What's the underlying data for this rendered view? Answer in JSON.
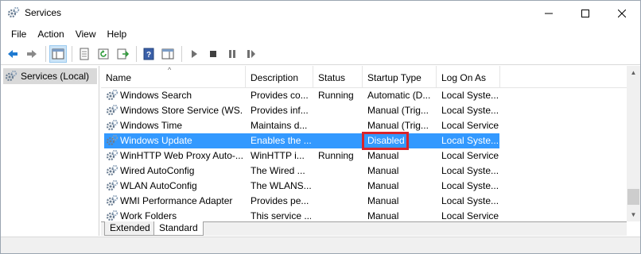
{
  "window": {
    "title": "Services",
    "minimize": "—",
    "maximize": "☐",
    "close": "✕"
  },
  "menu": {
    "file": "File",
    "action": "Action",
    "view": "View",
    "help": "Help"
  },
  "tree": {
    "item": "Services (Local)"
  },
  "columns": {
    "name": "Name",
    "description": "Description",
    "status": "Status",
    "startup": "Startup Type",
    "logon": "Log On As"
  },
  "rows": [
    {
      "name": "Windows Search",
      "description": "Provides co...",
      "status": "Running",
      "startup": "Automatic (D...",
      "logon": "Local Syste..."
    },
    {
      "name": "Windows Store Service (WS...",
      "description": "Provides inf...",
      "status": "",
      "startup": "Manual (Trig...",
      "logon": "Local Syste..."
    },
    {
      "name": "Windows Time",
      "description": "Maintains d...",
      "status": "",
      "startup": "Manual (Trig...",
      "logon": "Local Service"
    },
    {
      "name": "Windows Update",
      "description": "Enables the ...",
      "status": "",
      "startup": "Disabled",
      "logon": "Local Syste..."
    },
    {
      "name": "WinHTTP Web Proxy Auto-...",
      "description": "WinHTTP i...",
      "status": "Running",
      "startup": "Manual",
      "logon": "Local Service"
    },
    {
      "name": "Wired AutoConfig",
      "description": "The Wired ...",
      "status": "",
      "startup": "Manual",
      "logon": "Local Syste..."
    },
    {
      "name": "WLAN AutoConfig",
      "description": "The WLANS...",
      "status": "",
      "startup": "Manual",
      "logon": "Local Syste..."
    },
    {
      "name": "WMI Performance Adapter",
      "description": "Provides pe...",
      "status": "",
      "startup": "Manual",
      "logon": "Local Syste..."
    },
    {
      "name": "Work Folders",
      "description": "This service ...",
      "status": "",
      "startup": "Manual",
      "logon": "Local Service"
    }
  ],
  "selected_row": "Windows Update",
  "tabs": {
    "extended": "Extended",
    "standard": "Standard"
  },
  "colors": {
    "selection": "#3399ff",
    "highlight_box": "#d9242b"
  }
}
